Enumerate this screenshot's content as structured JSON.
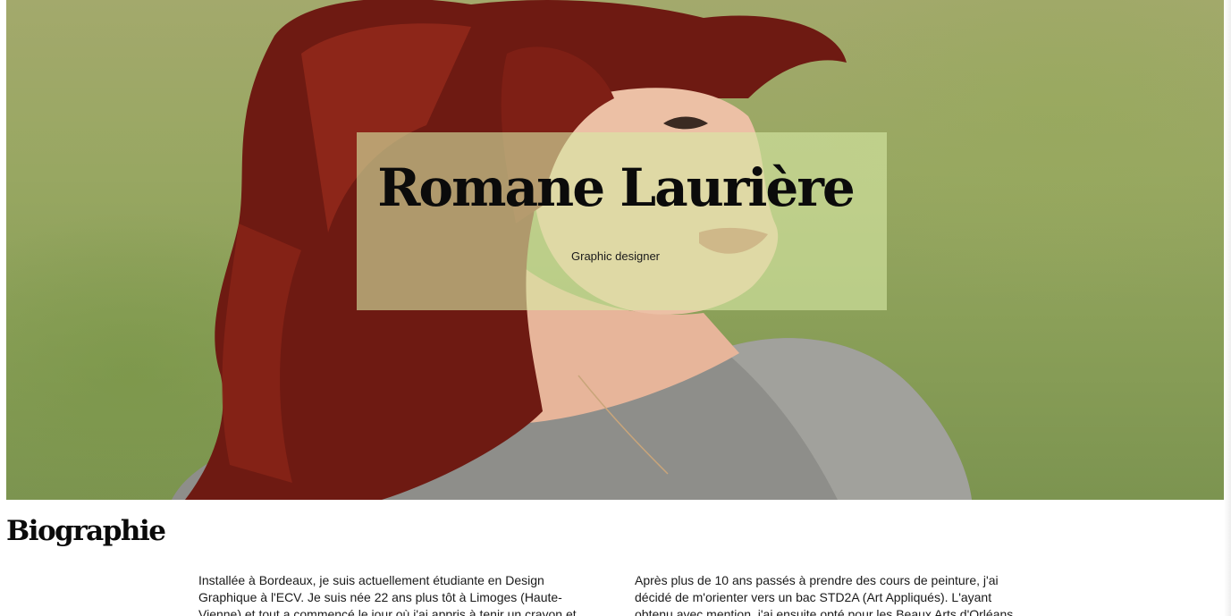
{
  "hero": {
    "name": "Romane Laurière",
    "subtitle": "Graphic designer"
  },
  "biography": {
    "heading": "Biographie",
    "column_left": "Installée à Bordeaux, je suis actuellement étudiante en Design Graphique à l'ECV. Je suis née 22 ans plus tôt à Limoges (Haute-Vienne) et tout a commencé le jour où j'ai appris à tenir un crayon et",
    "column_right": "Après plus de 10 ans passés à prendre des cours de peinture, j'ai décidé de m'orienter vers un bac STD2A (Art Appliqués). L'ayant obtenu avec mention, j'ai ensuite opté pour les Beaux Arts d'Orléans"
  },
  "colors": {
    "hero_green": "#8fa25c",
    "title_box": "#d6e8a5",
    "hair": "#7a1a12",
    "text": "#0b0b0b"
  }
}
